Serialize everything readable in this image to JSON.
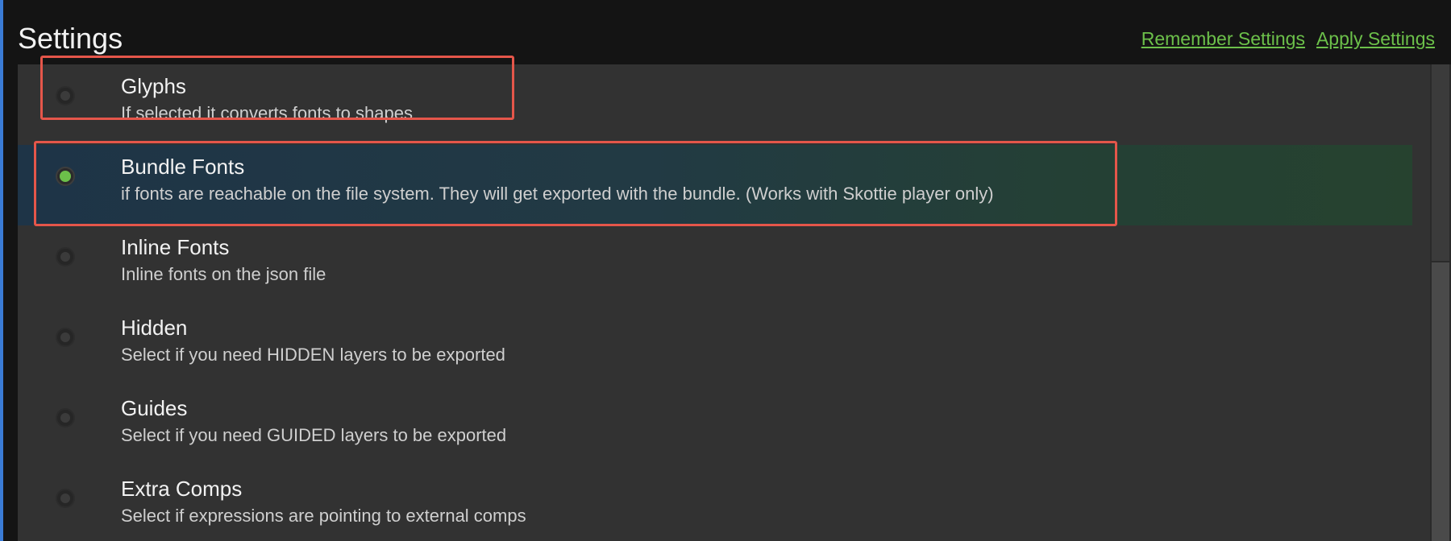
{
  "header": {
    "title": "Settings",
    "remember_label": "Remember Settings",
    "apply_label": "Apply Settings"
  },
  "options": [
    {
      "title": "Glyphs",
      "description": "If selected it converts fonts to shapes",
      "selected": false
    },
    {
      "title": "Bundle Fonts",
      "description": "if fonts are reachable on the file system. They will get exported with the bundle. (Works with Skottie player only)",
      "selected": true
    },
    {
      "title": "Inline Fonts",
      "description": "Inline fonts on the json file",
      "selected": false
    },
    {
      "title": "Hidden",
      "description": "Select if you need HIDDEN layers to be exported",
      "selected": false
    },
    {
      "title": "Guides",
      "description": "Select if you need GUIDED layers to be exported",
      "selected": false
    },
    {
      "title": "Extra Comps",
      "description": "Select if expressions are pointing to external comps",
      "selected": false
    }
  ],
  "colors": {
    "accent": "#6cc04a",
    "highlight": "#e5564a",
    "panel": "#323232",
    "background": "#141414"
  },
  "icons": {
    "radio_unselected": "radio-unselected-icon",
    "radio_selected": "radio-selected-icon"
  }
}
